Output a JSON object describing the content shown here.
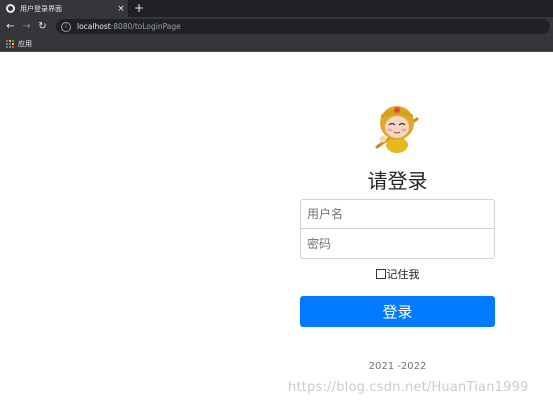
{
  "browser": {
    "tab_title": "用户登录界面",
    "tab_close": "×",
    "new_tab": "+",
    "url_host": "localhost",
    "url_rest": ":8080/toLoginPage",
    "bookmark_apps_label": "应用",
    "nav": {
      "back": "←",
      "forward": "→",
      "reload": "↻",
      "info": "i"
    }
  },
  "login": {
    "heading": "请登录",
    "username_placeholder": "用户名",
    "password_placeholder": "密码",
    "remember_label": "记住我",
    "submit_label": "登录",
    "copyright": "2021 -2022"
  },
  "watermark": "https://blog.csdn.net/HuanTian1999",
  "colors": {
    "primary": "#007bff",
    "chrome_dark": "#202124",
    "chrome_toolbar": "#35363a"
  },
  "icons": [
    "globe-icon",
    "close-icon",
    "plus-icon",
    "back-arrow-icon",
    "forward-arrow-icon",
    "reload-icon",
    "info-icon",
    "apps-grid-icon",
    "monkey-avatar"
  ]
}
